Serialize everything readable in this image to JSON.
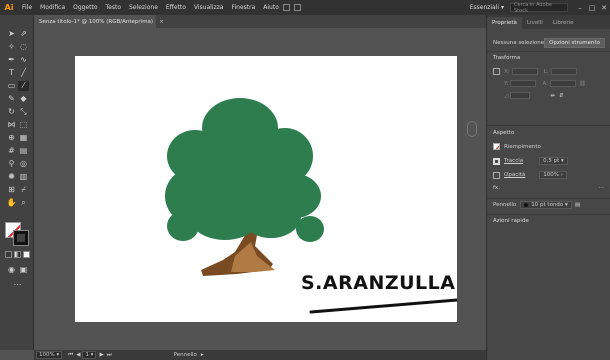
{
  "app": {
    "logo": "Ai"
  },
  "menu": [
    "File",
    "Modifica",
    "Oggetto",
    "Testo",
    "Selezione",
    "Effetto",
    "Visualizza",
    "Finestra",
    "Aiuto"
  ],
  "workspace": "Essenziali",
  "search_placeholder": "Cerca in Adobe Stock",
  "window_controls": {
    "minimize": "–",
    "maximize": "□",
    "close": "✕"
  },
  "doc_tab": {
    "title": "Senza titolo-1* @ 100% (RGB/Anteprima)",
    "close": "×"
  },
  "artboard": {
    "signature": "S.ARANZULLA"
  },
  "status": {
    "zoom": "100%",
    "page": "1",
    "tool": "Pennello"
  },
  "panel": {
    "tabs": [
      "Proprietà",
      "Livelli",
      "Librerie"
    ],
    "no_selection": "Nessuna selezione",
    "tool_options_button": "Opzioni strumento",
    "transform_title": "Trasforma",
    "appearance_title": "Aspetto",
    "fill_label": "Riempimento",
    "stroke_label": "Traccia",
    "stroke_value": "0,5 pt",
    "opacity_label": "Opacità",
    "opacity_value": "100%",
    "fx_label": "fx.",
    "brush_label": "Pennello",
    "brush_value": "10 pt tondo",
    "quick_actions": "Azioni rapide"
  },
  "colors": {
    "fill": "#ffffff",
    "stroke": "#111111",
    "tree_foliage": "#2e7d4f",
    "tree_trunk": "#7a4a23"
  }
}
